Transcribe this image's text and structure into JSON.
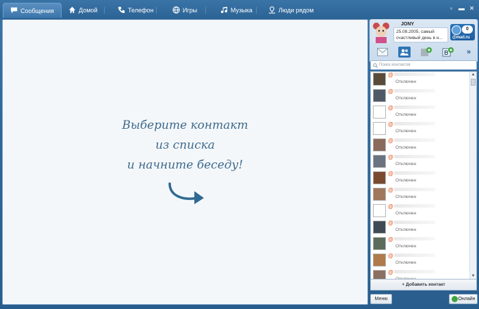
{
  "tabs": [
    {
      "label": "Сообщения",
      "icon": "speech-bubble-icon"
    },
    {
      "label": "Домой",
      "icon": "home-icon"
    },
    {
      "label": "Телефон",
      "icon": "phone-icon"
    },
    {
      "label": "Игры",
      "icon": "globe-icon"
    },
    {
      "label": "Музыка",
      "icon": "music-icon"
    },
    {
      "label": "Люди рядом",
      "icon": "people-nearby-icon"
    }
  ],
  "window_buttons": [
    "▫",
    "▬",
    "✕"
  ],
  "main": {
    "prompt_line1": "Выберите контакт",
    "prompt_line2": "из списка",
    "prompt_line3": "и начните беседу!"
  },
  "profile": {
    "name": "JONY",
    "status_text": "25.08.2005, самый счастливый день в н...",
    "mail_count": "0",
    "mail_label": "@mail.ru"
  },
  "toolbar": [
    "envelope-icon",
    "contacts-icon",
    "add-microblog-icon",
    "vkontakte-icon"
  ],
  "search": {
    "placeholder": "Поиск контактов"
  },
  "contacts": [
    {
      "status": "Отключен",
      "avatar": "#5a4a3a"
    },
    {
      "status": "Отключен",
      "avatar": "#4f5a66"
    },
    {
      "status": "Отключен",
      "avatar": "#ffffff"
    },
    {
      "status": "Отключен",
      "avatar": "#ffffff"
    },
    {
      "status": "Отключен",
      "avatar": "#8a6a5a"
    },
    {
      "status": "Отключен",
      "avatar": "#6b7280"
    },
    {
      "status": "Отключен",
      "avatar": "#7a4a2f"
    },
    {
      "status": "Отключен",
      "avatar": "#a0775a"
    },
    {
      "status": "Отключен",
      "avatar": "#ffffff"
    },
    {
      "status": "Отключен",
      "avatar": "#3f4a54"
    },
    {
      "status": "Отключен",
      "avatar": "#5d6b5a"
    },
    {
      "status": "Отключен",
      "avatar": "#b07a4a"
    },
    {
      "status": "Отключен",
      "avatar": "#8a7060"
    }
  ],
  "add_contact_label": "Добавить контакт",
  "menu_label": "Меню",
  "online_label": "Онлайн"
}
